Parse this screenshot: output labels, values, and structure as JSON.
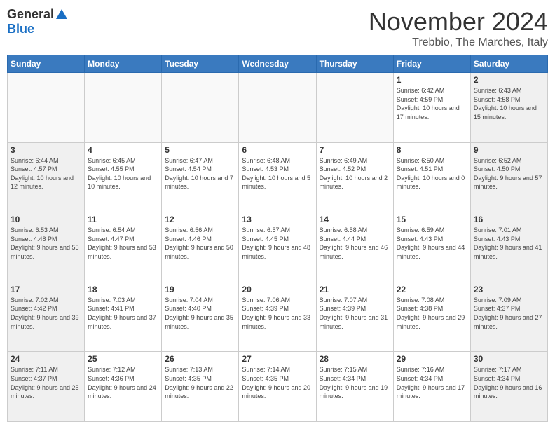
{
  "logo": {
    "general": "General",
    "blue": "Blue"
  },
  "title": "November 2024",
  "location": "Trebbio, The Marches, Italy",
  "days_of_week": [
    "Sunday",
    "Monday",
    "Tuesday",
    "Wednesday",
    "Thursday",
    "Friday",
    "Saturday"
  ],
  "weeks": [
    [
      {
        "day": "",
        "info": ""
      },
      {
        "day": "",
        "info": ""
      },
      {
        "day": "",
        "info": ""
      },
      {
        "day": "",
        "info": ""
      },
      {
        "day": "",
        "info": ""
      },
      {
        "day": "1",
        "info": "Sunrise: 6:42 AM\nSunset: 4:59 PM\nDaylight: 10 hours and 17 minutes."
      },
      {
        "day": "2",
        "info": "Sunrise: 6:43 AM\nSunset: 4:58 PM\nDaylight: 10 hours and 15 minutes."
      }
    ],
    [
      {
        "day": "3",
        "info": "Sunrise: 6:44 AM\nSunset: 4:57 PM\nDaylight: 10 hours and 12 minutes."
      },
      {
        "day": "4",
        "info": "Sunrise: 6:45 AM\nSunset: 4:55 PM\nDaylight: 10 hours and 10 minutes."
      },
      {
        "day": "5",
        "info": "Sunrise: 6:47 AM\nSunset: 4:54 PM\nDaylight: 10 hours and 7 minutes."
      },
      {
        "day": "6",
        "info": "Sunrise: 6:48 AM\nSunset: 4:53 PM\nDaylight: 10 hours and 5 minutes."
      },
      {
        "day": "7",
        "info": "Sunrise: 6:49 AM\nSunset: 4:52 PM\nDaylight: 10 hours and 2 minutes."
      },
      {
        "day": "8",
        "info": "Sunrise: 6:50 AM\nSunset: 4:51 PM\nDaylight: 10 hours and 0 minutes."
      },
      {
        "day": "9",
        "info": "Sunrise: 6:52 AM\nSunset: 4:50 PM\nDaylight: 9 hours and 57 minutes."
      }
    ],
    [
      {
        "day": "10",
        "info": "Sunrise: 6:53 AM\nSunset: 4:48 PM\nDaylight: 9 hours and 55 minutes."
      },
      {
        "day": "11",
        "info": "Sunrise: 6:54 AM\nSunset: 4:47 PM\nDaylight: 9 hours and 53 minutes."
      },
      {
        "day": "12",
        "info": "Sunrise: 6:56 AM\nSunset: 4:46 PM\nDaylight: 9 hours and 50 minutes."
      },
      {
        "day": "13",
        "info": "Sunrise: 6:57 AM\nSunset: 4:45 PM\nDaylight: 9 hours and 48 minutes."
      },
      {
        "day": "14",
        "info": "Sunrise: 6:58 AM\nSunset: 4:44 PM\nDaylight: 9 hours and 46 minutes."
      },
      {
        "day": "15",
        "info": "Sunrise: 6:59 AM\nSunset: 4:43 PM\nDaylight: 9 hours and 44 minutes."
      },
      {
        "day": "16",
        "info": "Sunrise: 7:01 AM\nSunset: 4:43 PM\nDaylight: 9 hours and 41 minutes."
      }
    ],
    [
      {
        "day": "17",
        "info": "Sunrise: 7:02 AM\nSunset: 4:42 PM\nDaylight: 9 hours and 39 minutes."
      },
      {
        "day": "18",
        "info": "Sunrise: 7:03 AM\nSunset: 4:41 PM\nDaylight: 9 hours and 37 minutes."
      },
      {
        "day": "19",
        "info": "Sunrise: 7:04 AM\nSunset: 4:40 PM\nDaylight: 9 hours and 35 minutes."
      },
      {
        "day": "20",
        "info": "Sunrise: 7:06 AM\nSunset: 4:39 PM\nDaylight: 9 hours and 33 minutes."
      },
      {
        "day": "21",
        "info": "Sunrise: 7:07 AM\nSunset: 4:39 PM\nDaylight: 9 hours and 31 minutes."
      },
      {
        "day": "22",
        "info": "Sunrise: 7:08 AM\nSunset: 4:38 PM\nDaylight: 9 hours and 29 minutes."
      },
      {
        "day": "23",
        "info": "Sunrise: 7:09 AM\nSunset: 4:37 PM\nDaylight: 9 hours and 27 minutes."
      }
    ],
    [
      {
        "day": "24",
        "info": "Sunrise: 7:11 AM\nSunset: 4:37 PM\nDaylight: 9 hours and 25 minutes."
      },
      {
        "day": "25",
        "info": "Sunrise: 7:12 AM\nSunset: 4:36 PM\nDaylight: 9 hours and 24 minutes."
      },
      {
        "day": "26",
        "info": "Sunrise: 7:13 AM\nSunset: 4:35 PM\nDaylight: 9 hours and 22 minutes."
      },
      {
        "day": "27",
        "info": "Sunrise: 7:14 AM\nSunset: 4:35 PM\nDaylight: 9 hours and 20 minutes."
      },
      {
        "day": "28",
        "info": "Sunrise: 7:15 AM\nSunset: 4:34 PM\nDaylight: 9 hours and 19 minutes."
      },
      {
        "day": "29",
        "info": "Sunrise: 7:16 AM\nSunset: 4:34 PM\nDaylight: 9 hours and 17 minutes."
      },
      {
        "day": "30",
        "info": "Sunrise: 7:17 AM\nSunset: 4:34 PM\nDaylight: 9 hours and 16 minutes."
      }
    ]
  ]
}
